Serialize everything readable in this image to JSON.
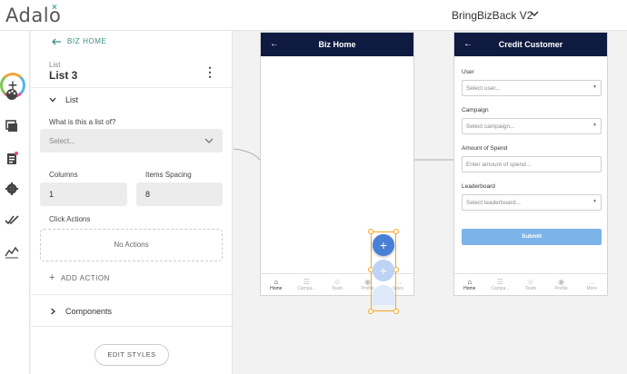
{
  "app": {
    "logo": "Adalo",
    "project_name": "BringBizBack V2"
  },
  "panel": {
    "back_label": "BIZ HOME",
    "component_type": "List",
    "component_name": "List 3",
    "section_list": "List",
    "list_of_label": "What is this a list of?",
    "list_of_placeholder": "Select...",
    "columns_label": "Columns",
    "columns_value": "1",
    "spacing_label": "Items Spacing",
    "spacing_value": "8",
    "click_actions_label": "Click Actions",
    "no_actions": "No Actions",
    "add_action": "ADD ACTION",
    "section_components": "Components",
    "edit_styles": "EDIT STYLES"
  },
  "screens": {
    "biz_home": {
      "title": "Biz Home"
    },
    "credit_customer": {
      "title": "Credit Customer",
      "user_label": "User",
      "user_placeholder": "Select user...",
      "campaign_label": "Campaign",
      "campaign_placeholder": "Select campaign...",
      "spend_label": "Amount of Spend",
      "spend_placeholder": "Enter amount of spend...",
      "leaderboard_label": "Leaderboard",
      "leaderboard_placeholder": "Select leaderboard...",
      "submit_label": "Submit"
    },
    "tabs": [
      "Home",
      "Campa...",
      "Team",
      "Profile",
      "More"
    ]
  },
  "fab": {
    "label": "+"
  },
  "colors": {
    "header": "#0e1a40",
    "accent": "#3a8d80",
    "selection": "#f5a623",
    "fab": "#4a7fd6",
    "submit": "#7cb3e8"
  }
}
